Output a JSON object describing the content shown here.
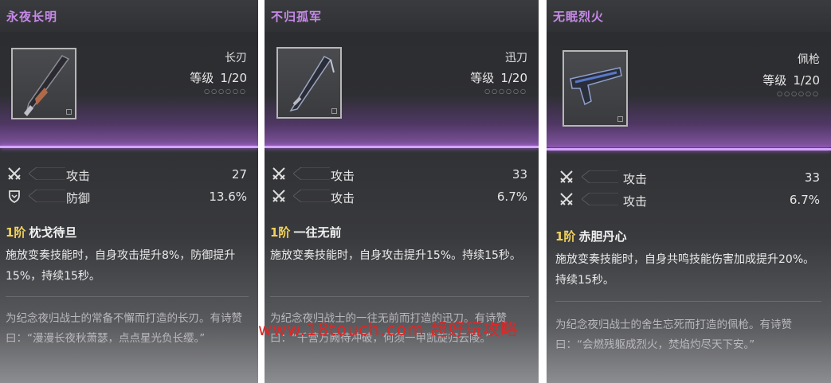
{
  "cards": [
    {
      "name": "永夜长明",
      "type": "长刃",
      "level_label": "等级",
      "level_value": "1/20",
      "stars": "○○○○○○",
      "stats": [
        {
          "icon": "crossed-swords-icon",
          "label": "攻击",
          "value": "27"
        },
        {
          "icon": "shield-icon",
          "label": "防御",
          "value": "13.6%"
        }
      ],
      "passive_rank": "1阶",
      "passive_name": "枕戈待旦",
      "passive_desc": "施放变奏技能时，自身攻击提升8%，防御提升15%，持续15秒。",
      "lore": "为纪念夜归战士的常备不懈而打造的长刃。有诗赞曰：“漫漫长夜秋萧瑟，点点星光负长缨。”"
    },
    {
      "name": "不归孤军",
      "type": "迅刀",
      "level_label": "等级",
      "level_value": "1/20",
      "stars": "○○○○○○",
      "stats": [
        {
          "icon": "crossed-swords-icon",
          "label": "攻击",
          "value": "33"
        },
        {
          "icon": "crossed-swords-icon",
          "label": "攻击",
          "value": "6.7%"
        }
      ],
      "passive_rank": "1阶",
      "passive_name": "一往无前",
      "passive_desc": "施放变奏技能时，自身攻击提升15%。持续15秒。",
      "lore": "为纪念夜归战士的一往无前而打造的迅刀。有诗赞曰：“千营万阙待冲破，何须一甲凯旋归云陵。”"
    },
    {
      "name": "无眠烈火",
      "type": "佩枪",
      "level_label": "等级",
      "level_value": "1/20",
      "stars": "○○○○○○",
      "stats": [
        {
          "icon": "crossed-swords-icon",
          "label": "攻击",
          "value": "33"
        },
        {
          "icon": "crossed-swords-icon",
          "label": "攻击",
          "value": "6.7%"
        }
      ],
      "passive_rank": "1阶",
      "passive_name": "赤胆丹心",
      "passive_desc": "施放变奏技能时，自身共鸣技能伤害加成提升20%。持续15秒。",
      "lore": "为纪念夜归战士的舍生忘死而打造的佩枪。有诗赞曰：“会燃残躯成烈火，焚焰灼尽天下安。”"
    }
  ],
  "watermark": "www.18touch.com 超好玩攻略",
  "colors": {
    "title": "#c58ae6",
    "rank": "#f3d25a",
    "accent_line": "#d6a4ff",
    "watermark": "#e02626"
  }
}
